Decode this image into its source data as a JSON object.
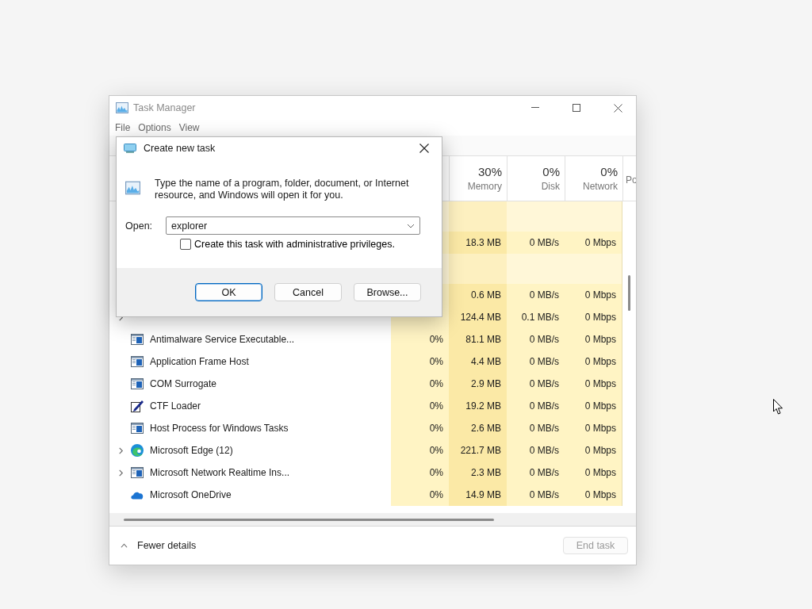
{
  "task_manager": {
    "title": "Task Manager",
    "menu": [
      "File",
      "Options",
      "View"
    ],
    "columns": [
      {
        "percent": "30%",
        "label": "Memory"
      },
      {
        "percent": "0%",
        "label": "Disk"
      },
      {
        "percent": "0%",
        "label": "Network"
      }
    ],
    "column_6": "Po",
    "rows": [
      {
        "kind": "group"
      },
      {
        "kind": "hidden",
        "memory": "18.3 MB",
        "disk": "0 MB/s",
        "network": "0 Mbps"
      },
      {
        "kind": "group"
      },
      {
        "kind": "hidden",
        "memory": "0.6 MB",
        "disk": "0 MB/s",
        "network": "0 Mbps"
      },
      {
        "kind": "hidden",
        "expandable": true,
        "memory": "124.4 MB",
        "disk": "0.1 MB/s",
        "network": "0 Mbps"
      },
      {
        "kind": "app",
        "name": "Antimalware Service Executable...",
        "expandable": false,
        "cpu": "0%",
        "memory": "81.1 MB",
        "disk": "0 MB/s",
        "network": "0 Mbps"
      },
      {
        "kind": "app",
        "name": "Application Frame Host",
        "expandable": false,
        "cpu": "0%",
        "memory": "4.4 MB",
        "disk": "0 MB/s",
        "network": "0 Mbps"
      },
      {
        "kind": "app",
        "name": "COM Surrogate",
        "expandable": false,
        "cpu": "0%",
        "memory": "2.9 MB",
        "disk": "0 MB/s",
        "network": "0 Mbps"
      },
      {
        "kind": "pen",
        "name": "CTF Loader",
        "expandable": false,
        "cpu": "0%",
        "memory": "19.2 MB",
        "disk": "0 MB/s",
        "network": "0 Mbps"
      },
      {
        "kind": "app",
        "name": "Host Process for Windows Tasks",
        "expandable": false,
        "cpu": "0%",
        "memory": "2.6 MB",
        "disk": "0 MB/s",
        "network": "0 Mbps"
      },
      {
        "kind": "browser",
        "name": "Microsoft Edge (12)",
        "expandable": true,
        "cpu": "0%",
        "memory": "221.7 MB",
        "disk": "0 MB/s",
        "network": "0 Mbps"
      },
      {
        "kind": "app",
        "name": "Microsoft Network Realtime Ins...",
        "expandable": true,
        "cpu": "0%",
        "memory": "2.3 MB",
        "disk": "0 MB/s",
        "network": "0 Mbps"
      },
      {
        "kind": "cloud",
        "name": "Microsoft OneDrive",
        "expandable": false,
        "cpu": "0%",
        "memory": "14.9 MB",
        "disk": "0 MB/s",
        "network": "0 Mbps"
      }
    ],
    "footer": {
      "toggle": "Fewer details",
      "end_task": {
        "label": "End task",
        "disabled": true
      }
    }
  },
  "dialog": {
    "title": "Create new task",
    "description": "Type the name of a program, folder, document, or Internet resource, and Windows will open it for you.",
    "open_label": "Open:",
    "open_value": "explorer",
    "admin_checkbox": {
      "label": "Create this task with administrative privileges.",
      "checked": false
    },
    "buttons": [
      {
        "label": "OK",
        "default": true
      },
      {
        "label": "Cancel",
        "default": false
      },
      {
        "label": "Browse...",
        "default": false
      }
    ]
  }
}
